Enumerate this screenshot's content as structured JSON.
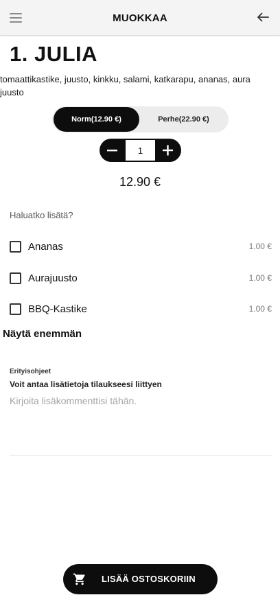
{
  "header": {
    "title": "MUOKKAA",
    "menu_icon": "hamburger-menu-icon",
    "back_icon": "arrow-left-icon"
  },
  "product": {
    "name": "1. JULIA",
    "description": "tomaattikastike, juusto, kinkku, salami, katkarapu, ananas, aura juusto",
    "sizes": [
      {
        "label": "Norm(12.90 €)",
        "selected": true
      },
      {
        "label": "Perhe(22.90 €)",
        "selected": false
      }
    ],
    "quantity": "1",
    "price": "12.90 €"
  },
  "addons": {
    "question": "Haluatko lisätä?",
    "items": [
      {
        "name": "Ananas",
        "price": "1.00 €",
        "checked": false
      },
      {
        "name": "Aurajuusto",
        "price": "1.00 €",
        "checked": false
      },
      {
        "name": "BBQ-Kastike",
        "price": "1.00 €",
        "checked": false
      }
    ],
    "show_more": "Näytä enemmän"
  },
  "special_instructions": {
    "label": "Erityisohjeet",
    "hint": "Voit antaa lisätietoja tilaukseesi liittyen",
    "placeholder": "Kirjoita lisäkommenttisi tähän."
  },
  "cart_button": {
    "label": "LISÄÄ OSTOSKORIIN",
    "icon": "shopping-cart-icon"
  },
  "colors": {
    "primary": "#0d0d0d",
    "topbar_bg": "#f4f4f4",
    "toggle_bg": "#ececec",
    "muted_text": "#777777",
    "placeholder": "#a3a3a3"
  }
}
